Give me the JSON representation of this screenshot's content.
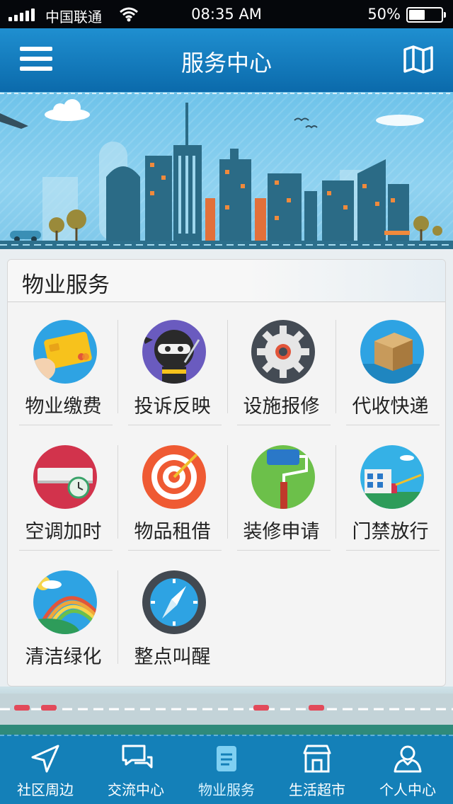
{
  "status_bar": {
    "carrier": "中国联通",
    "time": "08:35 AM",
    "battery_percent": "50%",
    "battery_level": 0.5,
    "wifi_icon": "wifi-icon",
    "signal_icon": "signal-bars-icon"
  },
  "header": {
    "title": "服务中心",
    "menu_icon": "hamburger-menu-icon",
    "map_icon": "map-icon"
  },
  "section": {
    "title": "物业服务",
    "items": [
      {
        "label": "物业缴费",
        "icon": "credit-card-icon"
      },
      {
        "label": "投诉反映",
        "icon": "ninja-icon"
      },
      {
        "label": "设施报修",
        "icon": "gear-icon"
      },
      {
        "label": "代收快递",
        "icon": "package-box-icon"
      },
      {
        "label": "空调加时",
        "icon": "air-conditioner-clock-icon"
      },
      {
        "label": "物品租借",
        "icon": "target-arrow-icon"
      },
      {
        "label": "装修申请",
        "icon": "paint-roller-icon"
      },
      {
        "label": "门禁放行",
        "icon": "gate-barrier-icon"
      },
      {
        "label": "清洁绿化",
        "icon": "rainbow-icon"
      },
      {
        "label": "整点叫醒",
        "icon": "compass-icon"
      }
    ]
  },
  "tabbar": {
    "active_index": 2,
    "tabs": [
      {
        "label": "社区周边",
        "icon": "location-arrow-icon"
      },
      {
        "label": "交流中心",
        "icon": "chat-bubbles-icon"
      },
      {
        "label": "物业服务",
        "icon": "scroll-document-icon"
      },
      {
        "label": "生活超市",
        "icon": "storefront-icon"
      },
      {
        "label": "个人中心",
        "icon": "person-icon"
      }
    ]
  },
  "colors": {
    "header_top": "#1f8fd0",
    "header_bottom": "#0b6aab",
    "tabbar": "#1480b8",
    "banner_sky": "#7fc8ea"
  }
}
